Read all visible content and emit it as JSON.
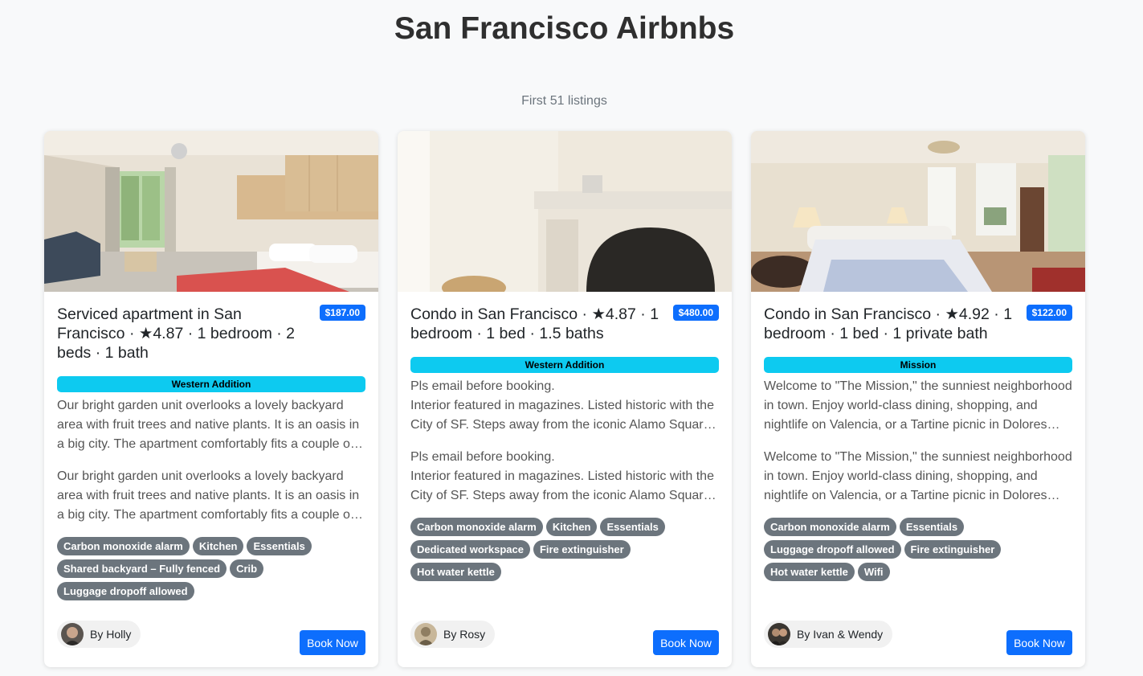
{
  "header": {
    "title": "San Francisco Airbnbs",
    "subtitle": "First 51 listings"
  },
  "listings": [
    {
      "title": "Serviced apartment in San Francisco · ★4.87 · 1 bedroom · 2 beds · 1 bath",
      "price": "$187.00",
      "neighborhood": "Western Addition",
      "description": "Our bright garden unit overlooks a lovely backyard area with fruit trees and native plants. It is an oasis in a big city. The apartment comfortably fits a couple or small family.",
      "description_full": "Our bright garden unit overlooks a lovely backyard area with fruit trees and native plants. It is an oasis in a big city. The apartment comfortably fits a couple or small family.",
      "amenities": [
        "Carbon monoxide alarm",
        "Kitchen",
        "Essentials",
        "Shared backyard – Fully fenced",
        "Crib",
        "Luggage dropoff allowed"
      ],
      "host": "By Holly",
      "book_label": "Book Now"
    },
    {
      "title": "Condo in San Francisco · ★4.87 · 1 bedroom · 1 bed · 1.5 baths",
      "price": "$480.00",
      "neighborhood": "Western Addition",
      "description": "Pls email before booking.\nInterior featured in magazines. Listed historic with the City of SF. Steps away from the iconic Alamo Square park.",
      "description_full": "Pls email before booking.\nInterior featured in magazines. Listed historic with the City of SF. Steps away from the iconic Alamo Square park.",
      "amenities": [
        "Carbon monoxide alarm",
        "Kitchen",
        "Essentials",
        "Dedicated workspace",
        "Fire extinguisher",
        "Hot water kettle"
      ],
      "host": "By Rosy",
      "book_label": "Book Now"
    },
    {
      "title": "Condo in San Francisco · ★4.92 · 1 bedroom · 1 bed · 1 private bath",
      "price": "$122.00",
      "neighborhood": "Mission",
      "description": "Welcome to \"The Mission,\" the sunniest neighborhood in town. Enjoy world-class dining, shopping, and nightlife on Valencia, or a Tartine picnic in Dolores Park.",
      "description_full": "Welcome to \"The Mission,\" the sunniest neighborhood in town. Enjoy world-class dining, shopping, and nightlife on Valencia, or a Tartine picnic in Dolores Park.",
      "amenities": [
        "Carbon monoxide alarm",
        "Essentials",
        "Luggage dropoff allowed",
        "Fire extinguisher",
        "Hot water kettle",
        "Wifi"
      ],
      "host": "By Ivan & Wendy",
      "book_label": "Book Now"
    }
  ],
  "colors": {
    "price_badge": "#0d6efd",
    "neighborhood_badge": "#0dcaf0",
    "amenity_badge": "#6c757d",
    "book_button": "#0d6efd"
  }
}
